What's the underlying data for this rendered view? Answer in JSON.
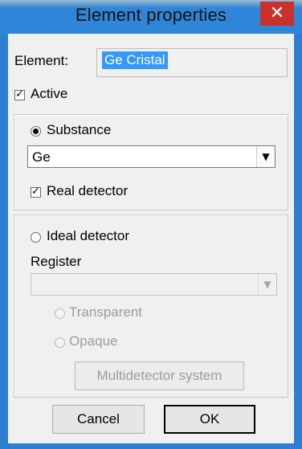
{
  "window": {
    "title": "Element properties",
    "close_glyph": "✕"
  },
  "element": {
    "label": "Element:",
    "value": "Ge Cristal"
  },
  "active": {
    "label": "Active",
    "checked": true
  },
  "substance": {
    "radio_label": "Substance",
    "selected": true,
    "combo_value": "Ge",
    "real_detector_label": "Real detector",
    "real_detector_checked": true
  },
  "ideal": {
    "radio_label": "Ideal detector",
    "selected": false,
    "register_label": "Register",
    "register_value": "",
    "transparent_label": "Transparent",
    "opaque_label": "Opaque",
    "multidetector_label": "Multidetector system"
  },
  "footer": {
    "cancel_label": "Cancel",
    "ok_label": "OK"
  },
  "icons": {
    "dropdown": "chevron-down-icon",
    "close": "close-icon",
    "check": "checkmark-icon"
  },
  "colors": {
    "titlebar": "#2f86d9",
    "close": "#c9312a",
    "selection": "#3399ff"
  }
}
